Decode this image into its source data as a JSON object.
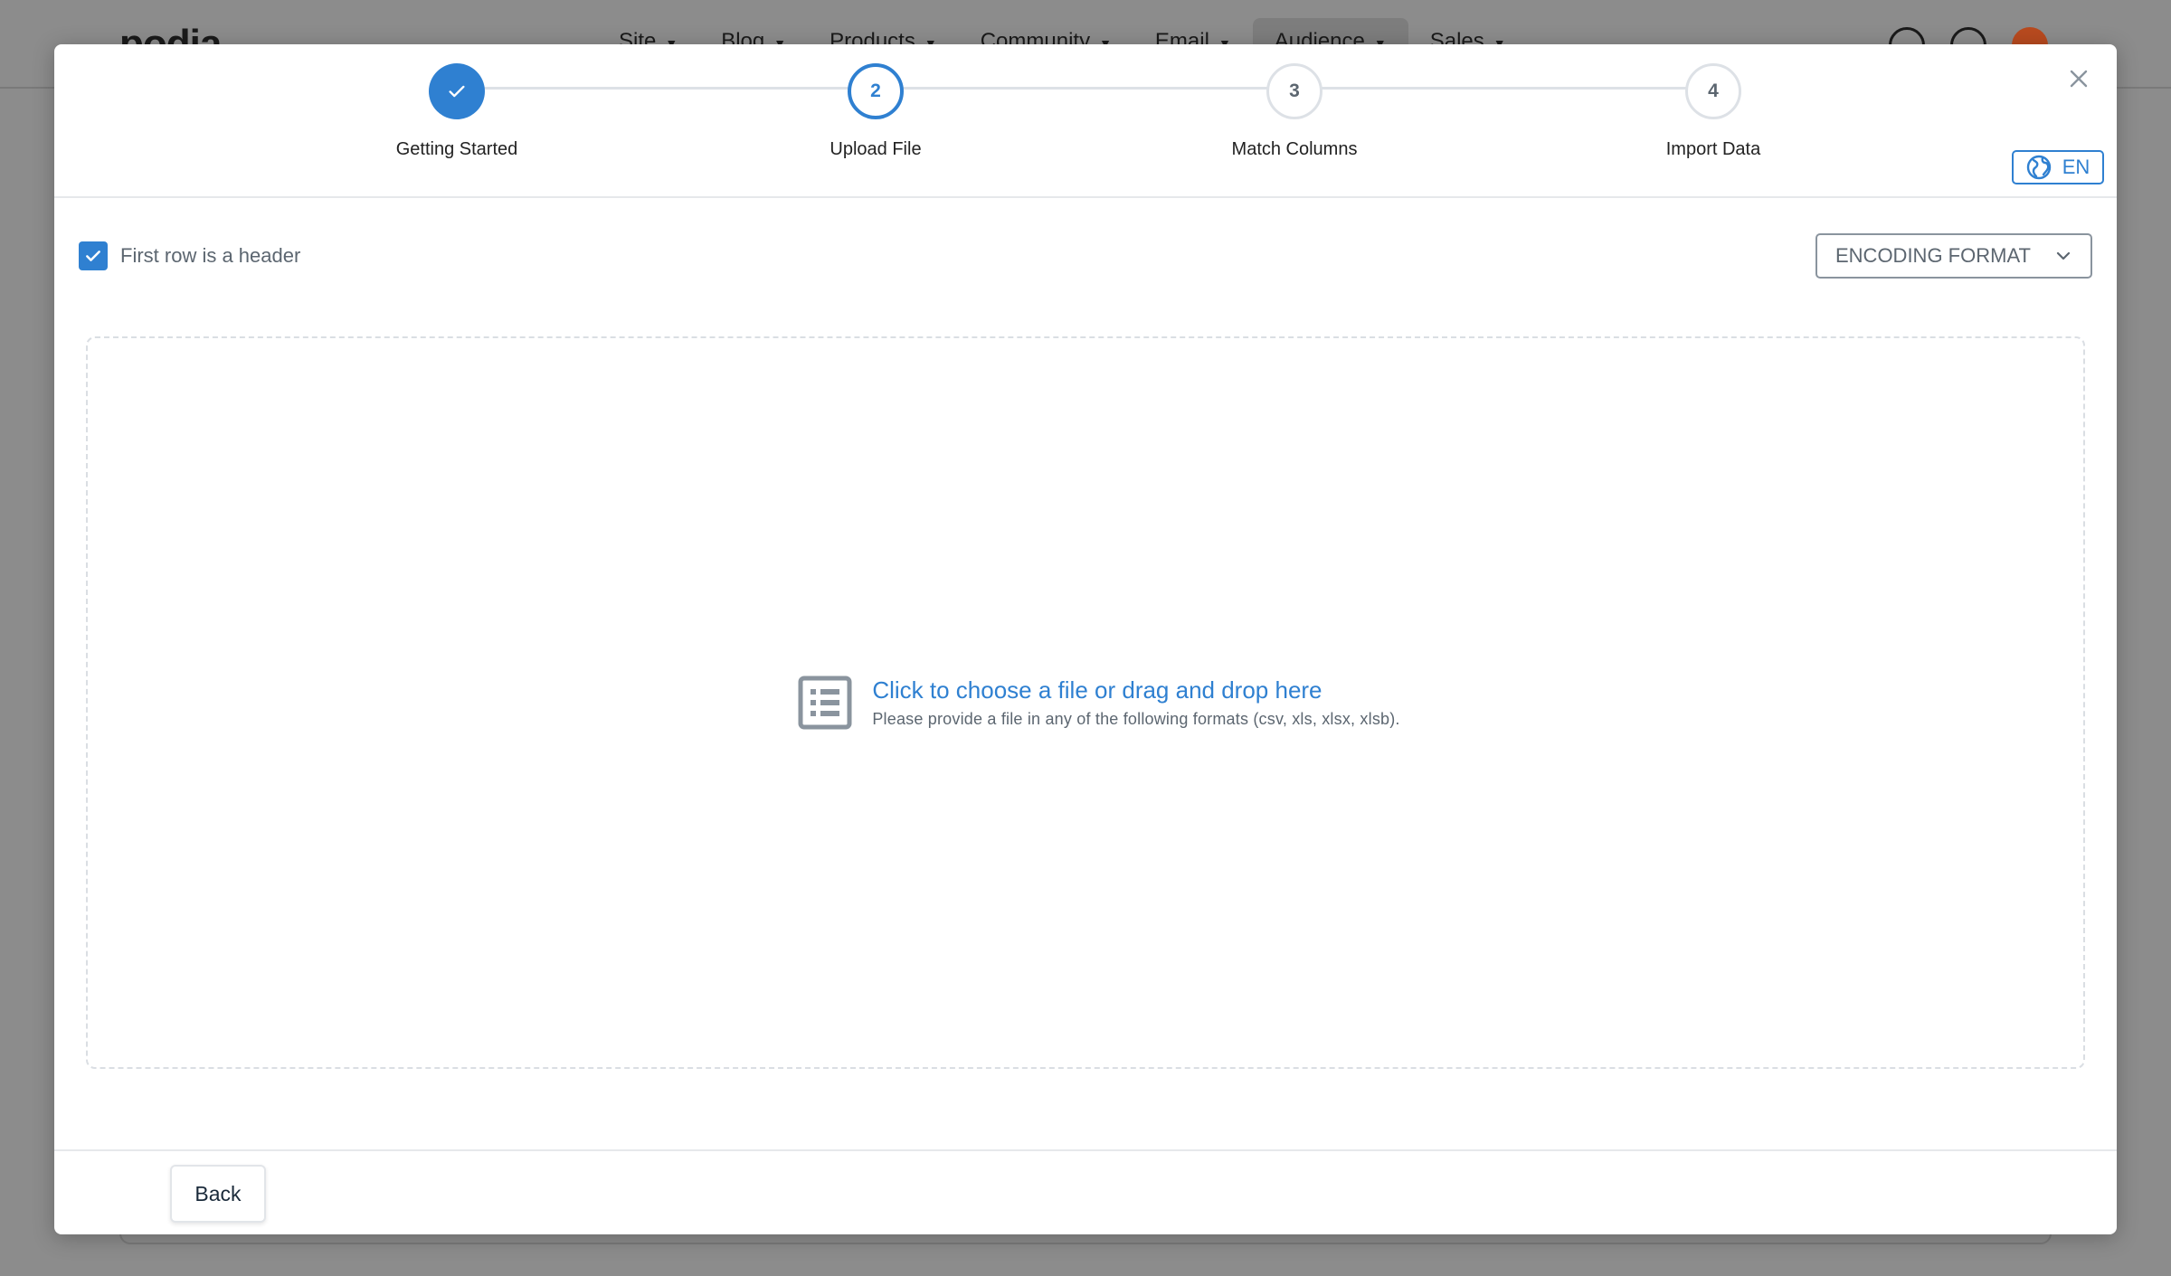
{
  "background": {
    "logo": "podia",
    "nav": [
      {
        "label": "Site"
      },
      {
        "label": "Blog"
      },
      {
        "label": "Products"
      },
      {
        "label": "Community"
      },
      {
        "label": "Email"
      },
      {
        "label": "Audience"
      },
      {
        "label": "Sales"
      }
    ],
    "active_nav": "Audience",
    "icons": [
      "search-icon",
      "help-icon",
      "avatar"
    ]
  },
  "modal": {
    "steps": [
      {
        "number": "1",
        "label": "Getting Started",
        "status": "done"
      },
      {
        "number": "2",
        "label": "Upload File",
        "status": "current"
      },
      {
        "number": "3",
        "label": "Match Columns",
        "status": "todo"
      },
      {
        "number": "4",
        "label": "Import Data",
        "status": "todo"
      }
    ],
    "language": "EN",
    "header_checkbox": {
      "label": "First row is a header",
      "checked": true
    },
    "encoding": {
      "label": "ENCODING FORMAT"
    },
    "dropzone": {
      "title": "Click to choose a file or drag and drop here",
      "subtitle": "Please provide a file in any of the following formats (csv, xls, xlsx, xlsb)."
    },
    "footer": {
      "back_label": "Back"
    }
  },
  "colors": {
    "accent": "#2f80d1",
    "overlay": "#8c8c8c",
    "muted_text": "#5c6670",
    "border": "#dde1e6"
  }
}
